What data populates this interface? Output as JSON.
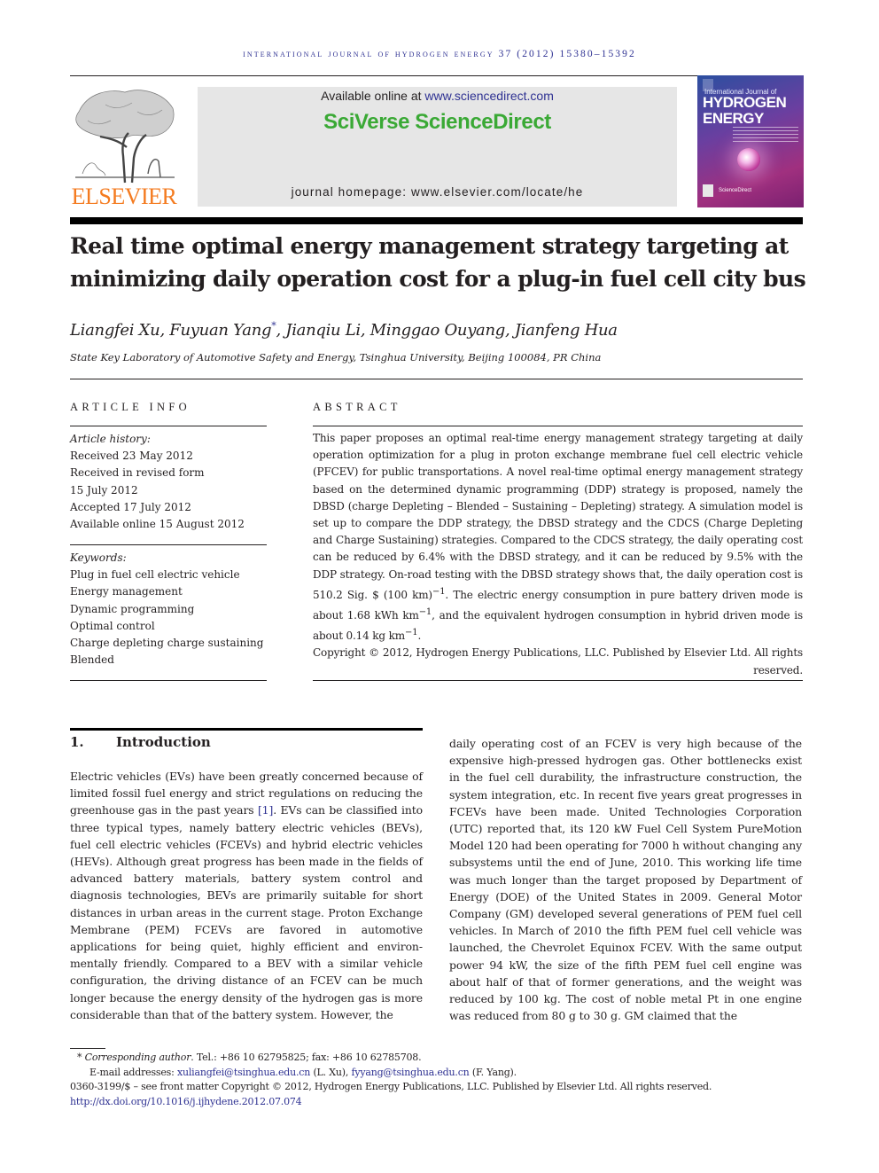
{
  "running_head": "International Journal of Hydrogen Energy 37 (2012) 15380–15392",
  "header": {
    "publisher_logo_text": "ELSEVIER",
    "available_online_prefix": "Available online at ",
    "available_online_link": "www.sciencedirect.com",
    "platform_name": "SciVerse ScienceDirect",
    "homepage_text": "journal homepage: www.elsevier.com/locate/he",
    "cover": {
      "line1": "International Journal of",
      "line2": "HYDROGEN",
      "line3": "ENERGY",
      "footer_logo": "ScienceDirect"
    },
    "colors": {
      "elsevier_orange": "#f47b20",
      "sciverse_green": "#3aa935",
      "link_blue": "#2e3192",
      "banner_gray": "#e6e6e6"
    }
  },
  "article": {
    "title": "Real time optimal energy management strategy targeting at minimizing daily operation cost for a plug-in fuel cell city bus",
    "authors_before": "Liangfei Xu, Fuyuan Yang",
    "corresponding_mark": "*",
    "authors_after": ", Jianqiu Li, Minggao Ouyang, Jianfeng Hua",
    "affiliation": "State Key Laboratory of Automotive Safety and Energy, Tsinghua University, Beijing 100084, PR China"
  },
  "article_info": {
    "heading": "ARTICLE INFO",
    "history_label": "Article history:",
    "history": [
      "Received 23 May 2012",
      "Received in revised form",
      "15 July 2012",
      "Accepted 17 July 2012",
      "Available online 15 August 2012"
    ],
    "keywords_label": "Keywords:",
    "keywords": [
      "Plug in fuel cell electric vehicle",
      "Energy management",
      "Dynamic programming",
      "Optimal control",
      "Charge depleting charge sustaining",
      "Blended"
    ]
  },
  "abstract": {
    "heading": "ABSTRACT",
    "p1": "This paper proposes an optimal real-time energy management strategy targeting at daily operation optimization for a plug in proton exchange membrane fuel cell electric vehicle (PFCEV) for public transportations. A novel real-time optimal energy management strategy based on the determined dynamic programming (DDP) strategy is proposed, namely the DBSD (charge Depleting – Blended – Sustaining – Depleting) strategy. A simulation model is set up to compare the DDP strategy, the DBSD strategy and the CDCS (Charge Depleting and Charge Sustaining) strategies. Compared to the CDCS strategy, the daily operating cost can be reduced by 6.4% with the DBSD strategy, and it can be reduced by 9.5% with the DDP strategy. On-road testing with the DBSD strategy shows that, the daily operation cost is 510.2 Sig. $ (100 km)",
    "sup1": "−1",
    "p2": ". The electric energy consumption in pure battery driven mode is about 1.68 kWh km",
    "sup2": "−1",
    "p3": ", and the equivalent hydrogen consumption in hybrid driven mode is about 0.14 kg km",
    "sup3": "−1",
    "p4": ".",
    "copyright": "Copyright © 2012, Hydrogen Energy Publications, LLC. Published by Elsevier Ltd. All rights reserved."
  },
  "introduction": {
    "number": "1.",
    "heading": "Introduction",
    "left_a": "Electric vehicles (EVs) have been greatly concerned because of limited fossil fuel energy and strict regulations on reducing the greenhouse gas in the past years ",
    "left_cite": "[1]",
    "left_b": ". EVs can be classified into three typical types, namely battery electric vehicles (BEVs), fuel cell electric vehicles (FCEVs) and hybrid electric vehicles (HEVs). Although great progress has been made in the fields of advanced battery materials, battery system control and diagnosis technologies, BEVs are primarily suitable for short distances in urban areas in the current stage. Proton Exchange Membrane (PEM) FCEVs are favored in automotive applications for being quiet, highly efficient and environ­mentally friendly. Compared to a BEV with a similar vehicle configuration, the driving distance of an FCEV can be much longer because the energy density of the hydrogen gas is more considerable than that of the battery system. However, the",
    "right": "daily operating cost of an FCEV is very high because of the expensive high-pressed hydrogen gas. Other bottlenecks exist in the fuel cell durability, the infrastructure construction, the system integration, etc. In recent five years great progresses in FCEVs have been made. United Technologies Corporation (UTC) reported that, its 120 kW Fuel Cell System PureMotion Model 120 had been operating for 7000 h without changing any subsystems until the end of June, 2010. This working life time was much longer than the target proposed by Department of Energy (DOE) of the United States in 2009. General Motor Company (GM) developed several generations of PEM fuel cell vehicles. In March of 2010 the fifth PEM fuel cell vehicle was launched, the Chevrolet Equinox FCEV. With the same output power 94 kW, the size of the fifth PEM fuel cell engine was about half of that of former generations, and the weight was reduced by 100 kg. The cost of noble metal Pt in one engine was reduced from 80 g to 30 g. GM claimed that the"
  },
  "footnotes": {
    "mark": "*",
    "corresponding_label": "Corresponding author",
    "contact": ". Tel.: +86 10 62795825; fax: +86 10 62785708.",
    "email_label": "E-mail addresses: ",
    "email1": "xuliangfei@tsinghua.edu.cn",
    "email1_owner": " (L. Xu), ",
    "email2": "fyyang@tsinghua.edu.cn",
    "email2_owner": " (F. Yang).",
    "issn_line": "0360-3199/$ – see front matter Copyright © 2012, Hydrogen Energy Publications, LLC. Published by Elsevier Ltd. All rights reserved.",
    "doi": "http://dx.doi.org/10.1016/j.ijhydene.2012.07.074"
  }
}
